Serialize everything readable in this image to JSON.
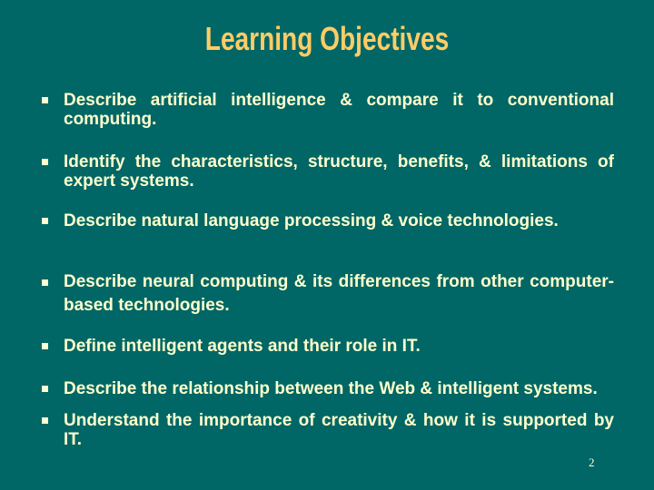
{
  "slide": {
    "title": "Learning Objectives",
    "page_number": "2",
    "colors": {
      "background": "#006666",
      "title": "#FFCC66",
      "body_text": "#FFFFCC"
    },
    "bullet_icon": "square-bullet",
    "objectives": [
      "Describe artificial intelligence & compare it to conventional computing.",
      "Identify the characteristics, structure, benefits, & limitations of expert systems.",
      "Describe natural language processing & voice technologies.",
      "Describe neural computing & its differences from other computer-based technologies.",
      "Define intelligent agents and their role in IT.",
      "Describe the relationship between the Web & intelligent systems.",
      "Understand the importance of creativity & how it is supported by IT."
    ]
  }
}
